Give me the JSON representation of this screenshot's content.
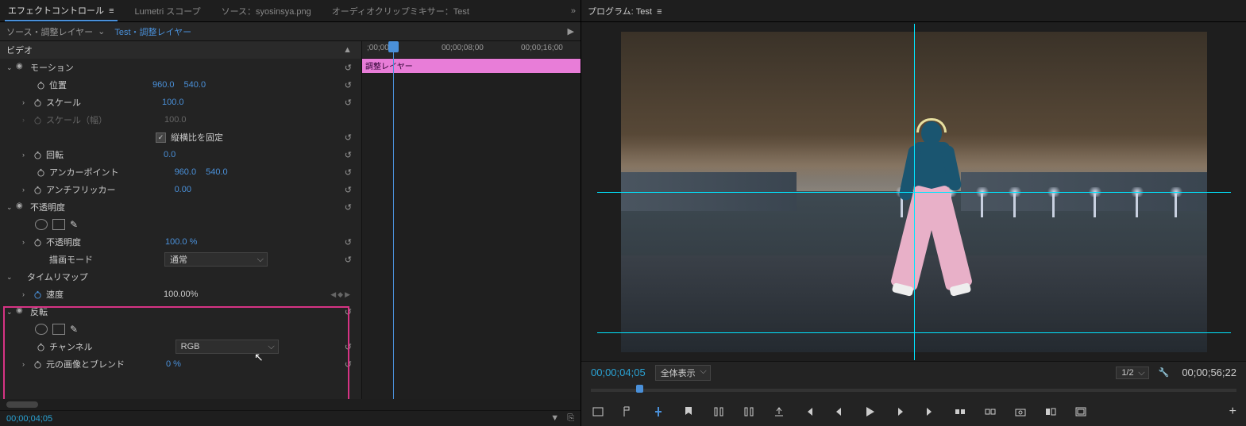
{
  "tabs": {
    "effect_controls": "エフェクトコントロール",
    "lumetri": "Lumetri スコープ",
    "source": "ソース：syosinsya.png",
    "audio_mixer": "オーディオクリップミキサー：Test"
  },
  "subheader": {
    "source_prefix": "ソース・調整レイヤー",
    "active": "Test・調整レイヤー"
  },
  "timeline": {
    "t0": ";00;00",
    "t1": "00;00;08;00",
    "t2": "00;00;16;00",
    "clip_label": "調整レイヤー"
  },
  "sections": {
    "video": "ビデオ",
    "motion": "モーション",
    "position": "位置",
    "position_x": "960.0",
    "position_y": "540.0",
    "scale": "スケール",
    "scale_val": "100.0",
    "scale_w": "スケール（幅）",
    "scale_w_val": "100.0",
    "uniform": "縦横比を固定",
    "rotation": "回転",
    "rotation_val": "0.0",
    "anchor": "アンカーポイント",
    "anchor_x": "960.0",
    "anchor_y": "540.0",
    "antiflicker": "アンチフリッカー",
    "antiflicker_val": "0.00",
    "opacity": "不透明度",
    "opacity_val": "100.0 %",
    "blend_mode": "描画モード",
    "blend_mode_val": "通常",
    "time_remap": "タイムリマップ",
    "speed": "速度",
    "speed_val": "100.00%",
    "invert": "反転",
    "channel": "チャンネル",
    "channel_val": "RGB",
    "blend_orig": "元の画像とブレンド",
    "blend_orig_val": "0 %"
  },
  "footer": {
    "timecode": "00;00;04;05"
  },
  "program": {
    "title": "プログラム: Test",
    "current_tc": "00;00;04;05",
    "fit": "全体表示",
    "res": "1/2",
    "duration": "00;00;56;22"
  }
}
